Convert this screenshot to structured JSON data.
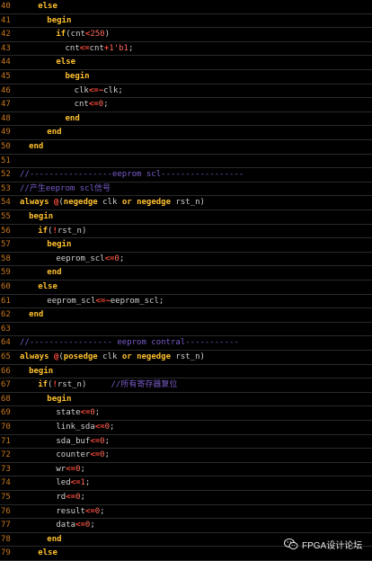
{
  "code_lines": [
    {
      "n": "40",
      "indent": 4,
      "tokens": [
        [
          "kw",
          "else"
        ]
      ]
    },
    {
      "n": "41",
      "indent": 6,
      "tokens": [
        [
          "kw",
          "begin"
        ]
      ]
    },
    {
      "n": "42",
      "indent": 8,
      "tokens": [
        [
          "kw",
          "if"
        ],
        [
          "txt",
          "(cnt"
        ],
        [
          "op",
          "<"
        ],
        [
          "num",
          "250"
        ],
        [
          "txt",
          ")"
        ]
      ]
    },
    {
      "n": "43",
      "indent": 10,
      "tokens": [
        [
          "txt",
          "cnt"
        ],
        [
          "op",
          "<="
        ],
        [
          "txt",
          "cnt"
        ],
        [
          "op",
          "+"
        ],
        [
          "num",
          "1'b1"
        ],
        [
          "txt",
          ";"
        ]
      ]
    },
    {
      "n": "44",
      "indent": 8,
      "tokens": [
        [
          "kw",
          "else"
        ]
      ]
    },
    {
      "n": "45",
      "indent": 10,
      "tokens": [
        [
          "kw",
          "begin"
        ]
      ]
    },
    {
      "n": "46",
      "indent": 12,
      "tokens": [
        [
          "txt",
          "clk"
        ],
        [
          "op",
          "<=~"
        ],
        [
          "txt",
          "clk;"
        ]
      ]
    },
    {
      "n": "47",
      "indent": 12,
      "tokens": [
        [
          "txt",
          "cnt"
        ],
        [
          "op",
          "<="
        ],
        [
          "num",
          "0"
        ],
        [
          "txt",
          ";"
        ]
      ]
    },
    {
      "n": "48",
      "indent": 10,
      "tokens": [
        [
          "kw",
          "end"
        ]
      ]
    },
    {
      "n": "49",
      "indent": 6,
      "tokens": [
        [
          "kw",
          "end"
        ]
      ]
    },
    {
      "n": "50",
      "indent": 2,
      "tokens": [
        [
          "kw",
          "end"
        ]
      ]
    },
    {
      "n": "51",
      "indent": 0,
      "tokens": []
    },
    {
      "n": "52",
      "indent": 0,
      "tokens": [
        [
          "cm",
          "//-----------------eeprom scl-----------------"
        ]
      ]
    },
    {
      "n": "53",
      "indent": 0,
      "tokens": [
        [
          "cm",
          "//产生eeprom scl信号"
        ]
      ]
    },
    {
      "n": "54",
      "indent": 0,
      "tokens": [
        [
          "kw",
          "always"
        ],
        [
          "txt",
          " "
        ],
        [
          "op",
          "@"
        ],
        [
          "txt",
          "("
        ],
        [
          "kw",
          "negedge"
        ],
        [
          "txt",
          " clk "
        ],
        [
          "kw",
          "or"
        ],
        [
          "txt",
          " "
        ],
        [
          "kw",
          "negedge"
        ],
        [
          "txt",
          " rst_n)"
        ]
      ]
    },
    {
      "n": "55",
      "indent": 2,
      "tokens": [
        [
          "kw",
          "begin"
        ]
      ]
    },
    {
      "n": "56",
      "indent": 4,
      "tokens": [
        [
          "kw",
          "if"
        ],
        [
          "txt",
          "("
        ],
        [
          "op",
          "!"
        ],
        [
          "txt",
          "rst_n)"
        ]
      ]
    },
    {
      "n": "57",
      "indent": 6,
      "tokens": [
        [
          "kw",
          "begin"
        ]
      ]
    },
    {
      "n": "58",
      "indent": 8,
      "tokens": [
        [
          "txt",
          "eeprom_scl"
        ],
        [
          "op",
          "<="
        ],
        [
          "num",
          "0"
        ],
        [
          "txt",
          ";"
        ]
      ]
    },
    {
      "n": "59",
      "indent": 6,
      "tokens": [
        [
          "kw",
          "end"
        ]
      ]
    },
    {
      "n": "60",
      "indent": 4,
      "tokens": [
        [
          "kw",
          "else"
        ]
      ]
    },
    {
      "n": "61",
      "indent": 6,
      "tokens": [
        [
          "txt",
          "eeprom_scl"
        ],
        [
          "op",
          "<=~"
        ],
        [
          "txt",
          "eeprom_scl;"
        ]
      ]
    },
    {
      "n": "62",
      "indent": 2,
      "tokens": [
        [
          "kw",
          "end"
        ]
      ]
    },
    {
      "n": "63",
      "indent": 0,
      "tokens": []
    },
    {
      "n": "64",
      "indent": 0,
      "tokens": [
        [
          "cm",
          "//----------------- eeprom contral-----------"
        ]
      ]
    },
    {
      "n": "65",
      "indent": 0,
      "tokens": [
        [
          "kw",
          "always"
        ],
        [
          "txt",
          " "
        ],
        [
          "op",
          "@"
        ],
        [
          "txt",
          "("
        ],
        [
          "kw",
          "posedge"
        ],
        [
          "txt",
          " clk "
        ],
        [
          "kw",
          "or"
        ],
        [
          "txt",
          " "
        ],
        [
          "kw",
          "negedge"
        ],
        [
          "txt",
          " rst_n)"
        ]
      ]
    },
    {
      "n": "66",
      "indent": 2,
      "tokens": [
        [
          "kw",
          "begin"
        ]
      ]
    },
    {
      "n": "67",
      "indent": 4,
      "tokens": [
        [
          "kw",
          "if"
        ],
        [
          "txt",
          "("
        ],
        [
          "op",
          "!"
        ],
        [
          "txt",
          "rst_n)     "
        ],
        [
          "cm",
          "//所有寄存器复位"
        ]
      ]
    },
    {
      "n": "68",
      "indent": 6,
      "tokens": [
        [
          "kw",
          "begin"
        ]
      ]
    },
    {
      "n": "69",
      "indent": 8,
      "tokens": [
        [
          "txt",
          "state"
        ],
        [
          "op",
          "<="
        ],
        [
          "num",
          "0"
        ],
        [
          "txt",
          ";"
        ]
      ]
    },
    {
      "n": "70",
      "indent": 8,
      "tokens": [
        [
          "txt",
          "link_sda"
        ],
        [
          "op",
          "<="
        ],
        [
          "num",
          "0"
        ],
        [
          "txt",
          ";"
        ]
      ]
    },
    {
      "n": "71",
      "indent": 8,
      "tokens": [
        [
          "txt",
          "sda_buf"
        ],
        [
          "op",
          "<="
        ],
        [
          "num",
          "0"
        ],
        [
          "txt",
          ";"
        ]
      ]
    },
    {
      "n": "72",
      "indent": 8,
      "tokens": [
        [
          "txt",
          "counter"
        ],
        [
          "op",
          "<="
        ],
        [
          "num",
          "0"
        ],
        [
          "txt",
          ";"
        ]
      ]
    },
    {
      "n": "73",
      "indent": 8,
      "tokens": [
        [
          "txt",
          "wr"
        ],
        [
          "op",
          "<="
        ],
        [
          "num",
          "0"
        ],
        [
          "txt",
          ";"
        ]
      ]
    },
    {
      "n": "74",
      "indent": 8,
      "tokens": [
        [
          "txt",
          "led"
        ],
        [
          "op",
          "<="
        ],
        [
          "num",
          "1"
        ],
        [
          "txt",
          ";"
        ]
      ]
    },
    {
      "n": "75",
      "indent": 8,
      "tokens": [
        [
          "txt",
          "rd"
        ],
        [
          "op",
          "<="
        ],
        [
          "num",
          "0"
        ],
        [
          "txt",
          ";"
        ]
      ]
    },
    {
      "n": "76",
      "indent": 8,
      "tokens": [
        [
          "txt",
          "result"
        ],
        [
          "op",
          "<="
        ],
        [
          "num",
          "0"
        ],
        [
          "txt",
          ";"
        ]
      ]
    },
    {
      "n": "77",
      "indent": 8,
      "tokens": [
        [
          "txt",
          "data"
        ],
        [
          "op",
          "<="
        ],
        [
          "num",
          "0"
        ],
        [
          "txt",
          ";"
        ]
      ]
    },
    {
      "n": "78",
      "indent": 6,
      "tokens": [
        [
          "kw",
          "end"
        ]
      ]
    },
    {
      "n": "79",
      "indent": 4,
      "tokens": [
        [
          "kw",
          "else"
        ]
      ]
    }
  ],
  "watermark": {
    "label": "FPGA设计论坛",
    "icon": "wechat-icon"
  },
  "colors": {
    "background": "#000000",
    "line_number": "#c8781e",
    "keyword": "#ffc12e",
    "operator": "#ff4d3d",
    "number": "#ff6a5a",
    "comment": "#7a5cc9",
    "text": "#d0d0d0"
  }
}
